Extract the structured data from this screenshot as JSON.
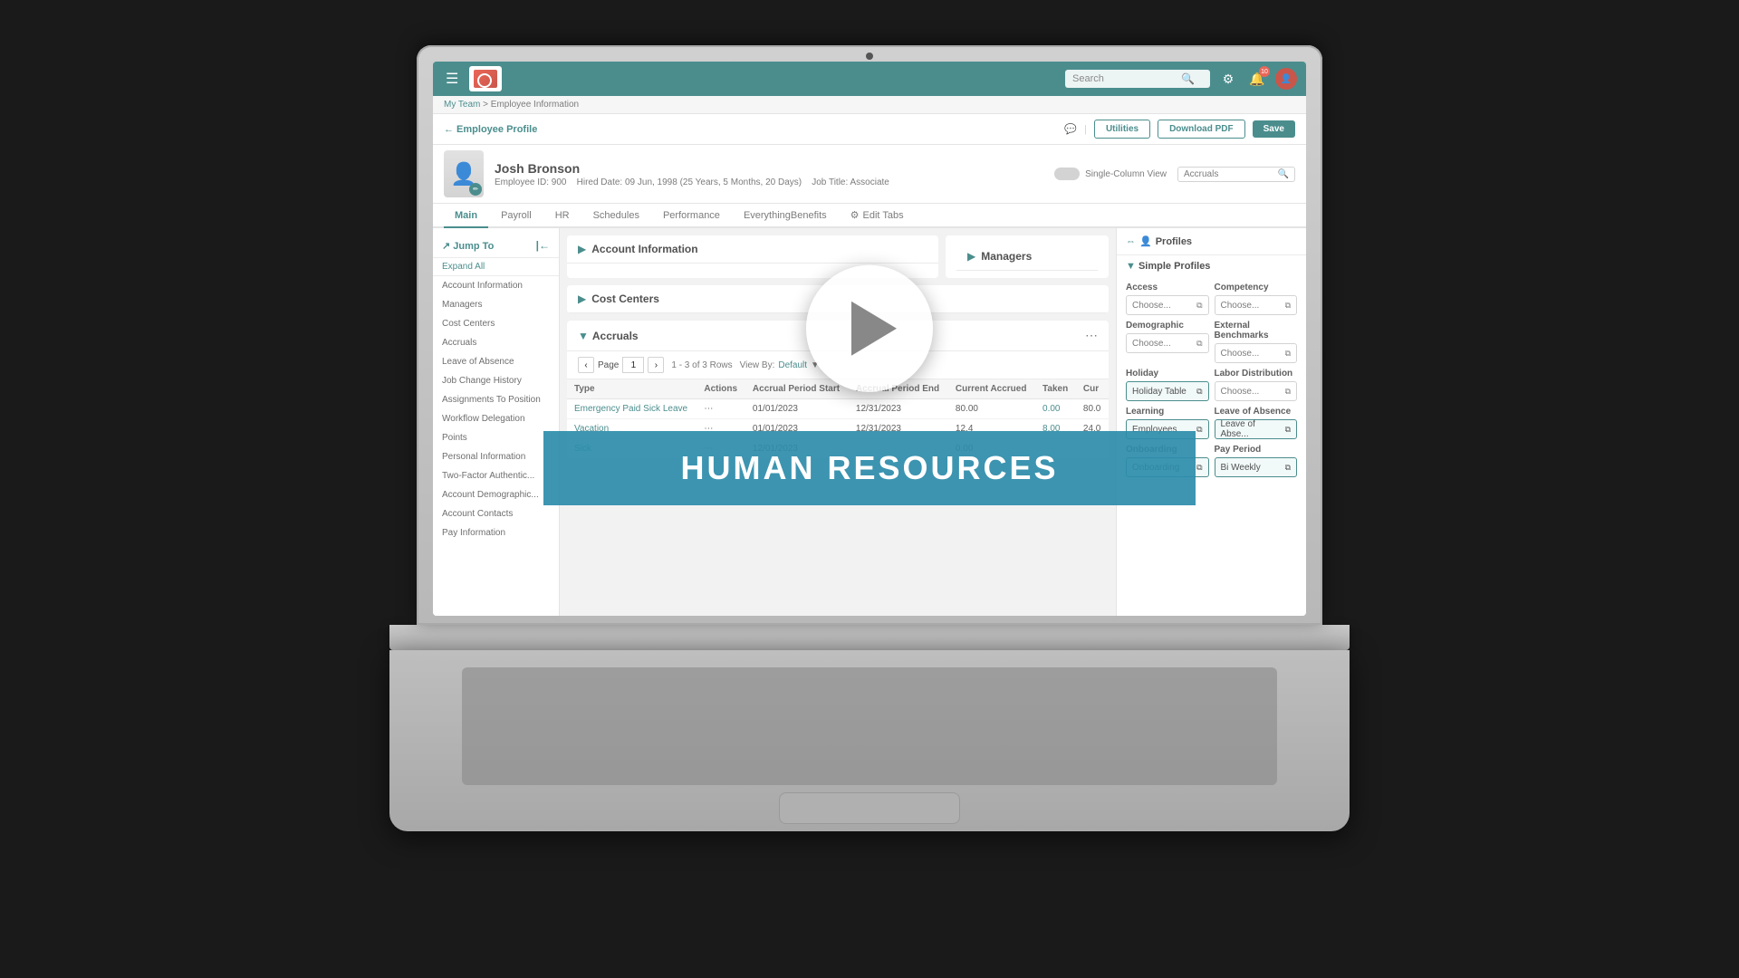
{
  "app": {
    "title": "HR Employee Profile",
    "logo_alt": "App Logo"
  },
  "nav": {
    "search_placeholder": "Search",
    "notification_count": "10",
    "hamburger_label": "☰",
    "settings_icon": "⚙",
    "bell_icon": "🔔",
    "user_icon": "👤"
  },
  "breadcrumb": {
    "parent": "My Team",
    "separator": ">",
    "current": "Employee Information"
  },
  "profile_header": {
    "back_label": "← Employee Profile",
    "utilities_label": "Utilities",
    "download_pdf_label": "Download PDF",
    "save_label": "Save",
    "single_column_label": "Single-Column View",
    "accruals_placeholder": "Accruals"
  },
  "employee": {
    "name": "Josh Bronson",
    "employee_id": "Employee ID: 900",
    "hire_date": "Hired Date: 09 Jun, 1998 (25 Years, 5 Months, 20 Days)",
    "job_title_label": "Job Title:",
    "job_title": "Associate"
  },
  "tabs": [
    {
      "label": "Main",
      "active": true
    },
    {
      "label": "Payroll",
      "active": false
    },
    {
      "label": "HR",
      "active": false
    },
    {
      "label": "Schedules",
      "active": false
    },
    {
      "label": "Performance",
      "active": false
    },
    {
      "label": "EverythingBenefits",
      "active": false
    },
    {
      "label": "Edit Tabs",
      "active": false
    }
  ],
  "jump_to": {
    "label": "Jump To",
    "expand_all": "Expand All",
    "items": [
      "Account Information",
      "Managers",
      "Cost Centers",
      "Accruals",
      "Leave of Absence",
      "Job Change History",
      "Assignments To Position",
      "Workflow Delegation",
      "Points",
      "Personal Information",
      "Two-Factor Authentic...",
      "Account Demographic...",
      "Account Contacts",
      "Pay Information"
    ]
  },
  "account_information": {
    "title": "Account Information"
  },
  "managers": {
    "title": "Managers"
  },
  "accruals": {
    "title": "Accruals",
    "page_label": "Page",
    "page_num": "1",
    "rows_label": "1 - 3 of 3 Rows",
    "view_by_label": "View By:",
    "view_by_value": "Default",
    "columns": [
      "Type",
      "Actions",
      "Accrual Period Start",
      "Accrual Period End",
      "Current Accrued",
      "Taken",
      "Cur"
    ],
    "rows": [
      {
        "type": "Emergency Paid Sick Leave",
        "period_start": "01/01/2023",
        "period_end": "12/31/2023",
        "current_accrued": "80.00",
        "taken": "0.00",
        "current": "80.0"
      },
      {
        "type": "Vacation",
        "period_start": "01/01/2023",
        "period_end": "12/31/2023",
        "current_accrued": "12.4",
        "taken": "8.00",
        "current": "24.0"
      },
      {
        "type": "Sick",
        "period_start": "12/01/2023",
        "period_end": "",
        "current_accrued": "0.00",
        "taken": "",
        "current": ""
      }
    ]
  },
  "profiles_sidebar": {
    "title": "Profiles",
    "section_title": "Simple Profiles",
    "items": [
      {
        "label": "Access",
        "value": "Choose...",
        "filled": false
      },
      {
        "label": "Competency",
        "value": "Choose...",
        "filled": false
      },
      {
        "label": "Demographic",
        "value": "Choose...",
        "filled": false
      },
      {
        "label": "External Benchmarks",
        "value": "Choose...",
        "filled": false
      },
      {
        "label": "Holiday",
        "value": "Holiday Table",
        "filled": true
      },
      {
        "label": "Labor Distribution",
        "value": "Choose...",
        "filled": false
      },
      {
        "label": "Learning",
        "value": "Employees",
        "filled": true
      },
      {
        "label": "Leave of Absence",
        "value": "Leave of Abse...",
        "filled": true
      },
      {
        "label": "Onboarding",
        "value": "Onboarding",
        "filled": true
      },
      {
        "label": "Pay Period",
        "value": "Bi Weekly",
        "filled": true
      }
    ]
  },
  "video_overlay": {
    "play_button_label": "Play Video"
  },
  "hr_banner": {
    "text": "HUMAN RESOURCES"
  }
}
